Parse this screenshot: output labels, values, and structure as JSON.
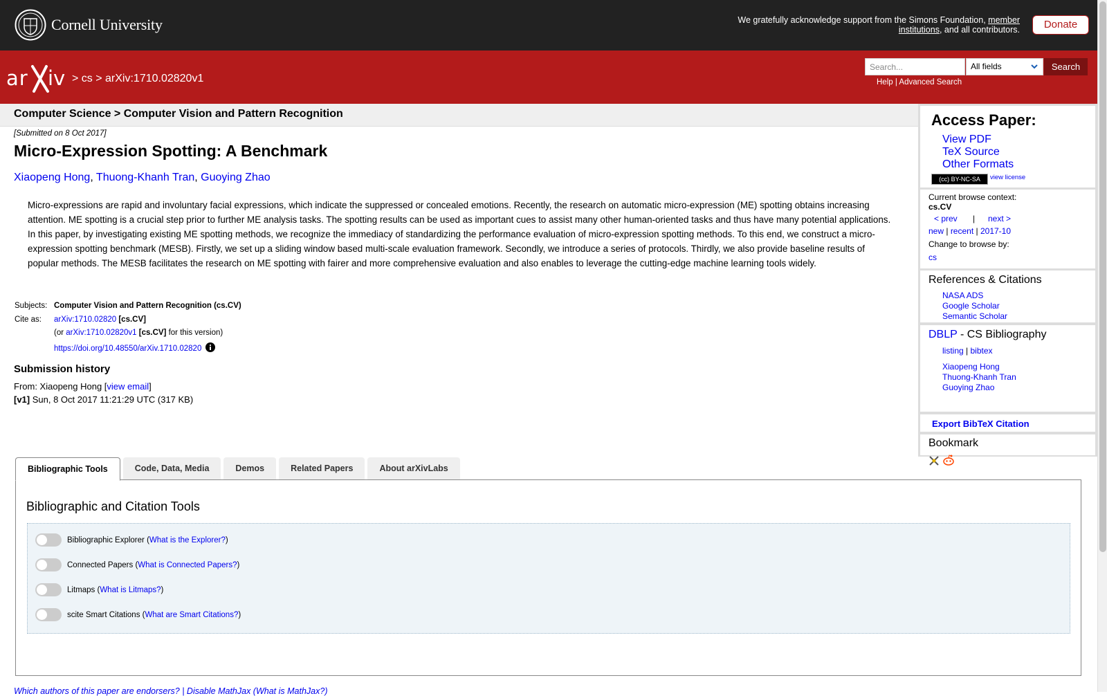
{
  "header": {
    "cornell_name": "Cornell University",
    "support_text_1": "We gratefully acknowledge support from the Simons Foundation, ",
    "support_link_1": "member institutions",
    "support_text_2": ", and all contributors.",
    "donate_label": "Donate"
  },
  "nav": {
    "breadcrumb": "> cs > arXiv:1710.02820v1",
    "search_placeholder": "Search...",
    "field_select": "All fields",
    "search_button": "Search",
    "help_link": "Help",
    "separator": " | ",
    "advanced_link": "Advanced Search"
  },
  "subheader": {
    "category": "Computer Science > Computer Vision and Pattern Recognition"
  },
  "paper": {
    "submitted": "[Submitted on 8 Oct 2017]",
    "title": "Micro-Expression Spotting: A Benchmark",
    "authors": [
      "Xiaopeng Hong",
      "Thuong-Khanh Tran",
      "Guoying Zhao"
    ],
    "author_sep": ", ",
    "abstract": "Micro-expressions are rapid and involuntary facial expressions, which indicate the suppressed or concealed emotions. Recently, the research on automatic micro-expression (ME) spotting obtains increasing attention. ME spotting is a crucial step prior to further ME analysis tasks. The spotting results can be used as important cues to assist many other human-oriented tasks and thus have many potential applications. In this paper, by investigating existing ME spotting methods, we recognize the immediacy of standardizing the performance evaluation of micro-expression spotting methods. To this end, we construct a micro-expression spotting benchmark (MESB). Firstly, we set up a sliding window based multi-scale evaluation framework. Secondly, we introduce a series of protocols. Thirdly, we also provide baseline results of popular methods. The MESB facilitates the research on ME spotting with fairer and more comprehensive evaluation and also enables to leverage the cutting-edge machine learning tools widely.",
    "subjects_label": "Subjects:",
    "subjects_value": "Computer Vision and Pattern Recognition (cs.CV)",
    "cite_label": "Cite as:",
    "cite_link": "arXiv:1710.02820",
    "cite_cat": " [cs.CV]",
    "cite2_pre": "(or ",
    "cite2_link": "arXiv:1710.02820v1",
    "cite2_cat": " [cs.CV]",
    "cite2_post": " for this version)",
    "doi": "https://doi.org/10.48550/arXiv.1710.02820",
    "history_title": "Submission history",
    "from_pre": "From: Xiaopeng Hong [",
    "from_link": "view email",
    "from_post": "]",
    "v1_label": "[v1]",
    "v1_text": " Sun, 8 Oct 2017 11:21:29 UTC (317 KB)"
  },
  "sidebar": {
    "access_title": "Access Paper:",
    "access_items": [
      "View PDF",
      "TeX Source",
      "Other Formats"
    ],
    "license_badge": "(cc) BY-NC-SA",
    "view_license": "view license",
    "context_label": "Current browse context:",
    "context_value": "cs.CV",
    "prev": "< prev",
    "pipe": "|",
    "next": "next >",
    "new": "new",
    "recent": "recent",
    "month": "2017-10",
    "change_label": "Change to browse by:",
    "change_value": "cs",
    "refs_title": "References & Citations",
    "refs_items": [
      "NASA ADS",
      "Google Scholar",
      "Semantic Scholar"
    ],
    "dblp_link": "DBLP",
    "dblp_rest": " - CS Bibliography",
    "listing": "listing",
    "bibtex": "bibtex",
    "dblp_authors": [
      "Xiaopeng Hong",
      "Thuong-Khanh Tran",
      "Guoying Zhao"
    ],
    "export": "Export BibTeX Citation",
    "bookmark_title": "Bookmark"
  },
  "tabs": [
    "Bibliographic Tools",
    "Code, Data, Media",
    "Demos",
    "Related Papers",
    "About arXivLabs"
  ],
  "tools": {
    "heading": "Bibliographic and Citation Tools",
    "items": [
      {
        "label": "Bibliographic Explorer",
        "link": "What is the Explorer?"
      },
      {
        "label": "Connected Papers",
        "link": "What is Connected Papers?"
      },
      {
        "label": "Litmaps",
        "link": "What is Litmaps?"
      },
      {
        "label": "scite Smart Citations",
        "link": "What are Smart Citations?"
      }
    ],
    "enabled": [
      false,
      false,
      false,
      false
    ]
  },
  "footer": {
    "endorsers": "Which authors of this paper are endorsers?",
    "disable_mathjax": "Disable MathJax",
    "what_mathjax": "What is MathJax?"
  },
  "colors": {
    "brand_red": "#b31b1b",
    "header_dark": "#222222",
    "link": "#0000ee"
  }
}
